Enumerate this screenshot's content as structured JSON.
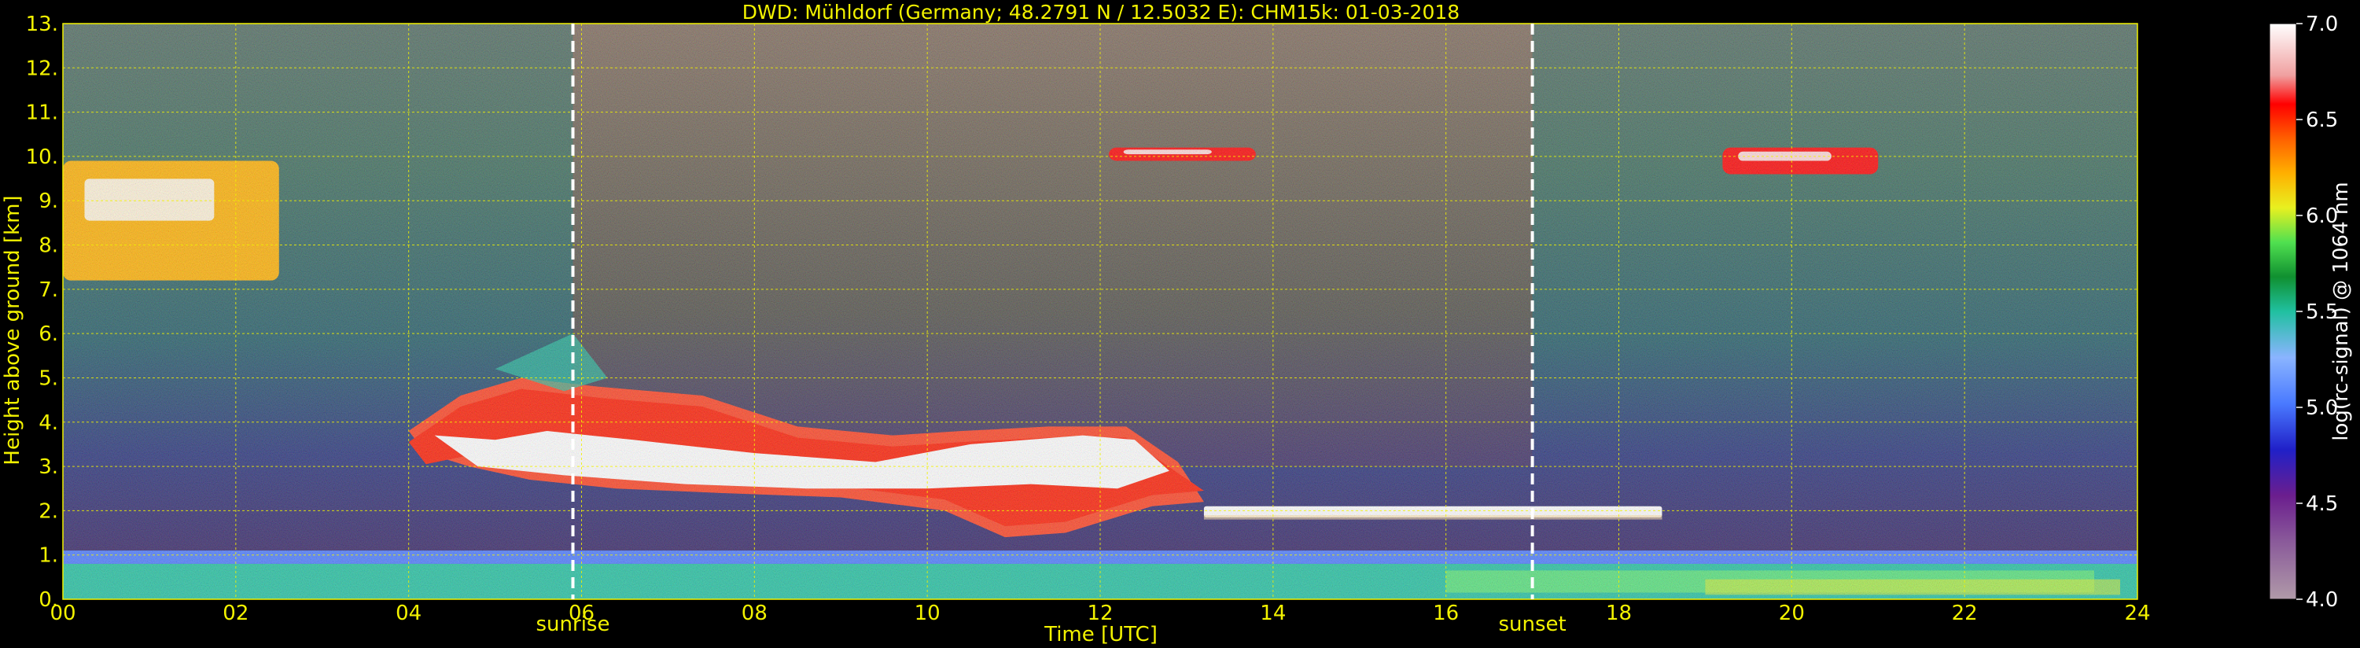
{
  "chart_data": {
    "type": "heatmap",
    "title": "DWD: Mühldorf (Germany; 48.2791 N / 12.5032 E):    CHM15k: 01-03-2018",
    "xlabel": "Time [UTC]",
    "ylabel": "Height above ground [km]",
    "xlim": [
      0,
      24
    ],
    "ylim": [
      0,
      13
    ],
    "xticks": [
      "00",
      "02",
      "04",
      "06",
      "08",
      "10",
      "12",
      "14",
      "16",
      "18",
      "20",
      "22",
      "24"
    ],
    "yticks": [
      "0.",
      "1.",
      "2.",
      "3.",
      "4.",
      "5.",
      "6.",
      "7.",
      "8.",
      "9.",
      "10.",
      "11.",
      "12.",
      "13."
    ],
    "grid": true,
    "colorbar": {
      "label": "log(rc-signal) @ 1064 nm",
      "range": [
        4.0,
        7.0
      ],
      "ticks": [
        "4.0",
        "4.5",
        "5.0",
        "5.5",
        "6.0",
        "6.5",
        "7.0"
      ]
    },
    "annotations": [
      {
        "label": "sunrise",
        "x": 5.9
      },
      {
        "label": "sunset",
        "x": 17.0
      }
    ],
    "features": [
      {
        "kind": "boundary-layer",
        "x": [
          0,
          24
        ],
        "height_km": [
          0,
          0.8
        ],
        "level": 5.6
      },
      {
        "kind": "residual-layer",
        "x": [
          0,
          24
        ],
        "height_km": [
          0.8,
          1.1
        ],
        "level": 5.0
      },
      {
        "kind": "cirrus",
        "x": [
          0,
          2.5
        ],
        "height_km": [
          7.2,
          9.9
        ],
        "level": 6.3
      },
      {
        "kind": "mid-level-cloud",
        "x": [
          4,
          13.2
        ],
        "height_km": [
          1.4,
          5.2
        ],
        "level": 7.0
      },
      {
        "kind": "low-cloud",
        "x": [
          13.2,
          18.5
        ],
        "height_km": [
          1.8,
          2.2
        ],
        "level": 7.0
      },
      {
        "kind": "cirrus",
        "x": [
          12.1,
          13.8
        ],
        "height_km": [
          9.9,
          10.2
        ],
        "level": 6.5
      },
      {
        "kind": "cirrus",
        "x": [
          19.2,
          21
        ],
        "height_km": [
          9.6,
          10.2
        ],
        "level": 6.5
      }
    ]
  }
}
